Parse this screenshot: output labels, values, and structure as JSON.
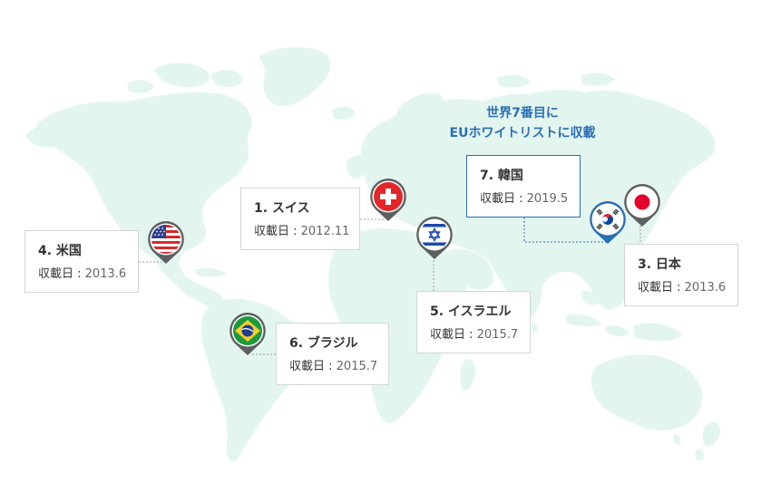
{
  "colors": {
    "land": "#e3f5ef",
    "card_border": "#d2d6da",
    "highlight": "#2a6fb5",
    "pin_ring": "#5d5f61",
    "connector": "#9aa0a6"
  },
  "note": {
    "line1": "世界7番目に",
    "line2": "EUホワイトリストに収載"
  },
  "countries": [
    {
      "id": "us",
      "title": "4. 米国",
      "label": "収載日 : ",
      "date": "2013.6",
      "flag": "usa-flag-icon"
    },
    {
      "id": "switzerland",
      "title": "1. スイス",
      "label": "収載日 : ",
      "date": "2012.11",
      "flag": "swiss-flag-icon"
    },
    {
      "id": "israel",
      "title": "5. イスラエル",
      "label": "収載日 : ",
      "date": "2015.7",
      "flag": "israel-flag-icon"
    },
    {
      "id": "brazil",
      "title": "6. ブラジル",
      "label": "収載日 : ",
      "date": "2015.7",
      "flag": "brazil-flag-icon"
    },
    {
      "id": "korea",
      "title": "7. 韓国",
      "label": "収載日 : ",
      "date": "2019.5",
      "flag": "korea-flag-icon"
    },
    {
      "id": "japan",
      "title": "3. 日本",
      "label": "収載日 : ",
      "date": "2013.6",
      "flag": "japan-flag-icon"
    }
  ]
}
